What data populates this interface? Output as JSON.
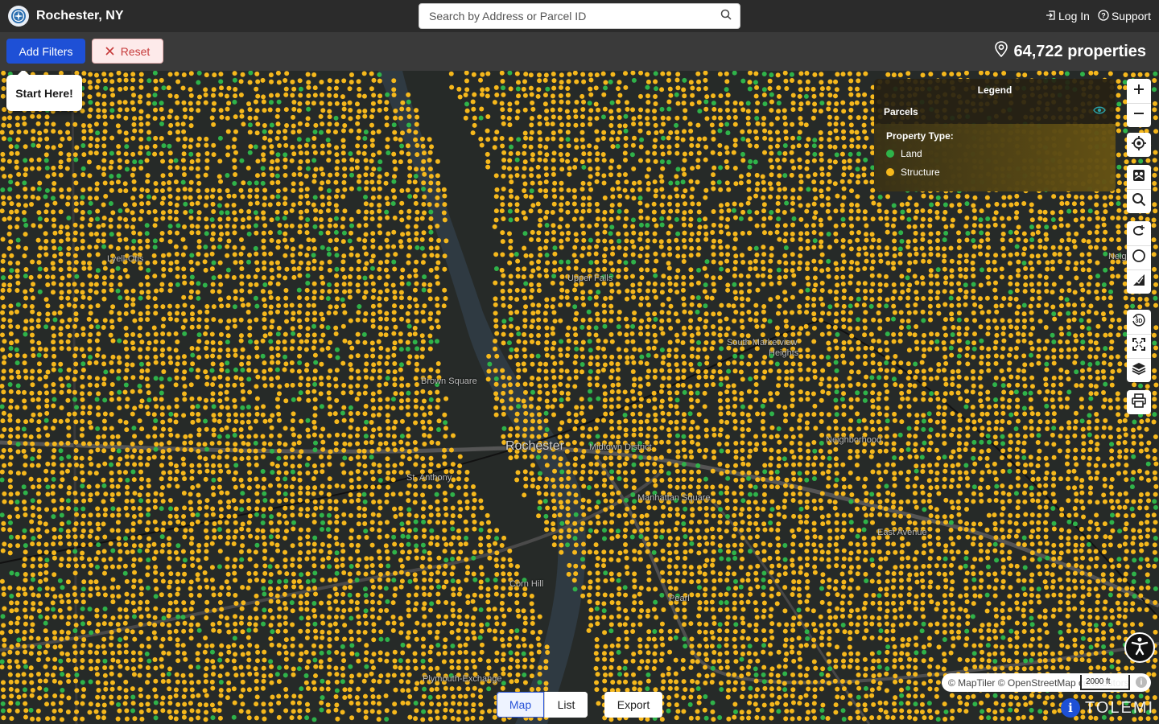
{
  "header": {
    "city_title": "Rochester, NY",
    "search_placeholder": "Search by Address or Parcel ID",
    "login_label": "Log In",
    "support_label": "Support"
  },
  "filters": {
    "add_filters_label": "Add Filters",
    "reset_label": "Reset",
    "property_count": "64,722 properties"
  },
  "onboarding": {
    "start_here": "Start Here!"
  },
  "legend": {
    "title": "Legend",
    "layer_name": "Parcels",
    "property_type_label": "Property Type:",
    "items": [
      {
        "label": "Land",
        "color": "#2fb34a"
      },
      {
        "label": "Structure",
        "color": "#f6b81c"
      }
    ]
  },
  "map_labels": {
    "city": "Rochester",
    "upper_falls": "Upper Falls",
    "south_marketview": "South Marketview",
    "heights": "Heights",
    "brown_square": "Brown Square",
    "st_anthony": "St. Anthony",
    "manhattan_square": "Manhattan Square",
    "east_avenue": "East Avenue",
    "neighborhood": "Neighborhood",
    "lyell": "Lyell-Otis",
    "pearl": "Pearl",
    "plymouth_exchange": "Plymouth-Exchange",
    "corn_hill": "Corn Hill",
    "midtown": "Midtown District",
    "neig": "Neig"
  },
  "bottom": {
    "map_label": "Map",
    "list_label": "List",
    "export_label": "Export",
    "attribution": "© MapTiler © OpenStreetMap contributors",
    "scale": "2000 ft",
    "brand": "TOLEMI"
  },
  "colors": {
    "land": "#2fb34a",
    "structure": "#f6b81c",
    "primary": "#1e50d6",
    "header_bg": "#2b2b2b"
  }
}
